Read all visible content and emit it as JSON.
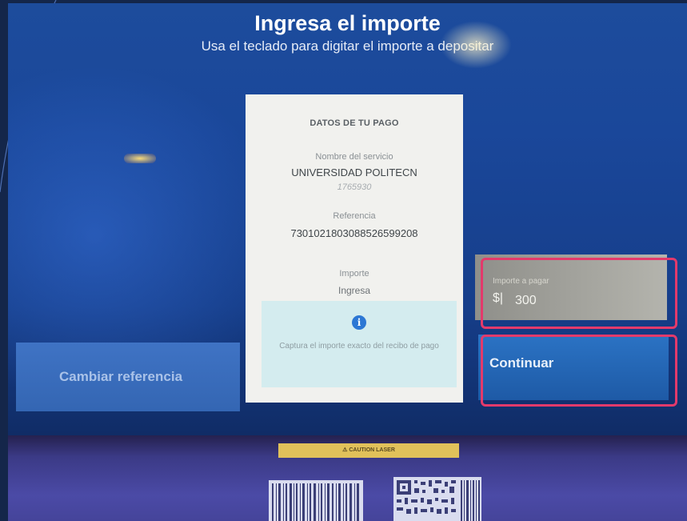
{
  "header": {
    "title": "Ingresa el importe",
    "subtitle": "Usa el teclado para digitar el importe a depositar"
  },
  "payment_card": {
    "heading": "DATOS DE TU PAGO",
    "service_label": "Nombre del servicio",
    "service_name": "UNIVERSIDAD POLITECN",
    "service_code": "1765930",
    "reference_label": "Referencia",
    "reference_value": "7301021803088526599208",
    "amount_label": "Importe",
    "amount_value": "Ingresa",
    "info_icon": "info-icon",
    "info_text": "Captura el importe exacto del recibo de pago"
  },
  "amount_field": {
    "label": "Importe a pagar",
    "currency": "$|",
    "value": "300"
  },
  "buttons": {
    "change_reference": "Cambiar referencia",
    "continue": "Continuar"
  },
  "bezel": {
    "laser_label": "CAUTION LASER"
  },
  "colors": {
    "screen_blue": "#1d4c9c",
    "card_bg": "#f1f1ee",
    "info_box": "#d4ecef",
    "highlight": "#e33a6b",
    "continue_button": "#2b73c4"
  }
}
